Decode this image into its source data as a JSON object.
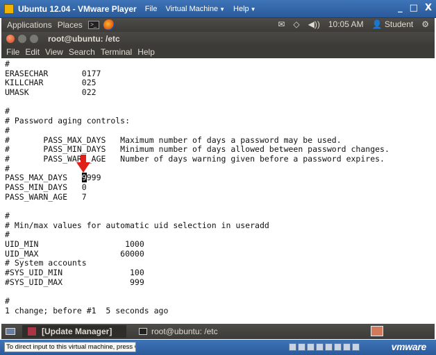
{
  "vmware": {
    "title": "Ubuntu 12.04 - VMware Player",
    "menus": [
      "File",
      "Virtual Machine",
      "Help"
    ],
    "controls": [
      "_",
      "□",
      "X"
    ],
    "status_hint": "To direct input to this virtual machine, press Ctrl+G.",
    "brand": "vmware"
  },
  "ubuntu_panel": {
    "applications": "Applications",
    "places": "Places",
    "time": "10:05 AM",
    "user": "Student"
  },
  "terminal": {
    "title": "root@ubuntu: /etc",
    "menu": [
      "File",
      "Edit",
      "View",
      "Search",
      "Terminal",
      "Help"
    ],
    "lines": [
      "#",
      "ERASECHAR       0177",
      "KILLCHAR        025",
      "UMASK           022",
      "",
      "#",
      "# Password aging controls:",
      "#",
      "#       PASS_MAX_DAYS   Maximum number of days a password may be used.",
      "#       PASS_MIN_DAYS   Minimum number of days allowed between password changes.",
      "#       PASS_WARN_AGE   Number of days warning given before a password expires.",
      "#",
      "PASS_MAX_DAYS   ",
      "PASS_MIN_DAYS   0",
      "PASS_WARN_AGE   7",
      "",
      "#",
      "# Min/max values for automatic uid selection in useradd",
      "#",
      "UID_MIN                  1000",
      "UID_MAX                 60000",
      "# System accounts",
      "#SYS_UID_MIN              100",
      "#SYS_UID_MAX              999",
      "",
      "#",
      "1 change; before #1  5 seconds ago"
    ],
    "cursor_char": "9",
    "after_cursor": "9999"
  },
  "taskbar": {
    "tasks": [
      "[Update Manager]",
      "root@ubuntu: /etc"
    ]
  },
  "colors": {
    "vm_blue": "#2a5a9a",
    "ubuntu_panel": "#3c3b37",
    "close_orange": "#dd4814",
    "arrow_red": "#e0201a"
  }
}
